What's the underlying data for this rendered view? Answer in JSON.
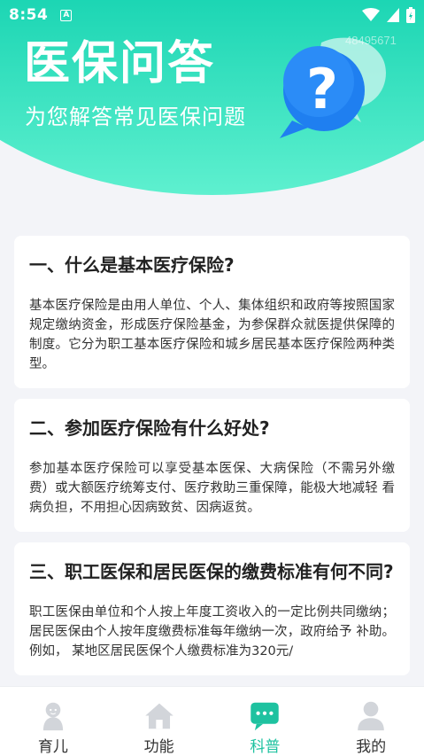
{
  "status_bar": {
    "time": "8:54",
    "notification_badge": "A"
  },
  "hero": {
    "title": "医保问答",
    "subtitle": "为您解答常见医保问题",
    "watermark": "48495671",
    "art_glyph": "?"
  },
  "faq": [
    {
      "question": "一、什么是基本医疗保险?",
      "answer": "基本医疗保险是由用人单位、个人、集体组织和政府等按照国家规定缴纳资金，形成医疗保险基金，为参保群众就医提供保障的制度。它分为职工基本医疗保险和城乡居民基本医疗保险两种类型。"
    },
    {
      "question": "二、参加医疗保险有什么好处?",
      "answer": "参加基本医疗保险可以享受基本医保、大病保险（不需另外缴 费）或大额医疗统筹支付、医疗救助三重保障，能极大地减轻 看病负担，不用担心因病致贫、因病返贫。"
    },
    {
      "question": "三、职工医保和居民医保的缴费标准有何不同?",
      "answer": "职工医保由单位和个人按上年度工资收入的一定比例共同缴纳；居民医保由个人按年度缴费标准每年缴纳一次，政府给予 补助。 例如， 某地区居民医保个人缴费标准为320元/"
    }
  ],
  "tabbar": {
    "items": [
      {
        "label": "育儿",
        "icon": "baby-icon",
        "active": false
      },
      {
        "label": "功能",
        "icon": "home-icon",
        "active": false
      },
      {
        "label": "科普",
        "icon": "chat-icon",
        "active": true
      },
      {
        "label": "我的",
        "icon": "person-icon",
        "active": false
      }
    ]
  },
  "colors": {
    "accent": "#1ec2a0",
    "hero_top": "#0bc7a7",
    "hero_bottom": "#5ef0cf",
    "bubble_blue": "#1f7ff0",
    "inactive_icon": "#d2d5da"
  }
}
